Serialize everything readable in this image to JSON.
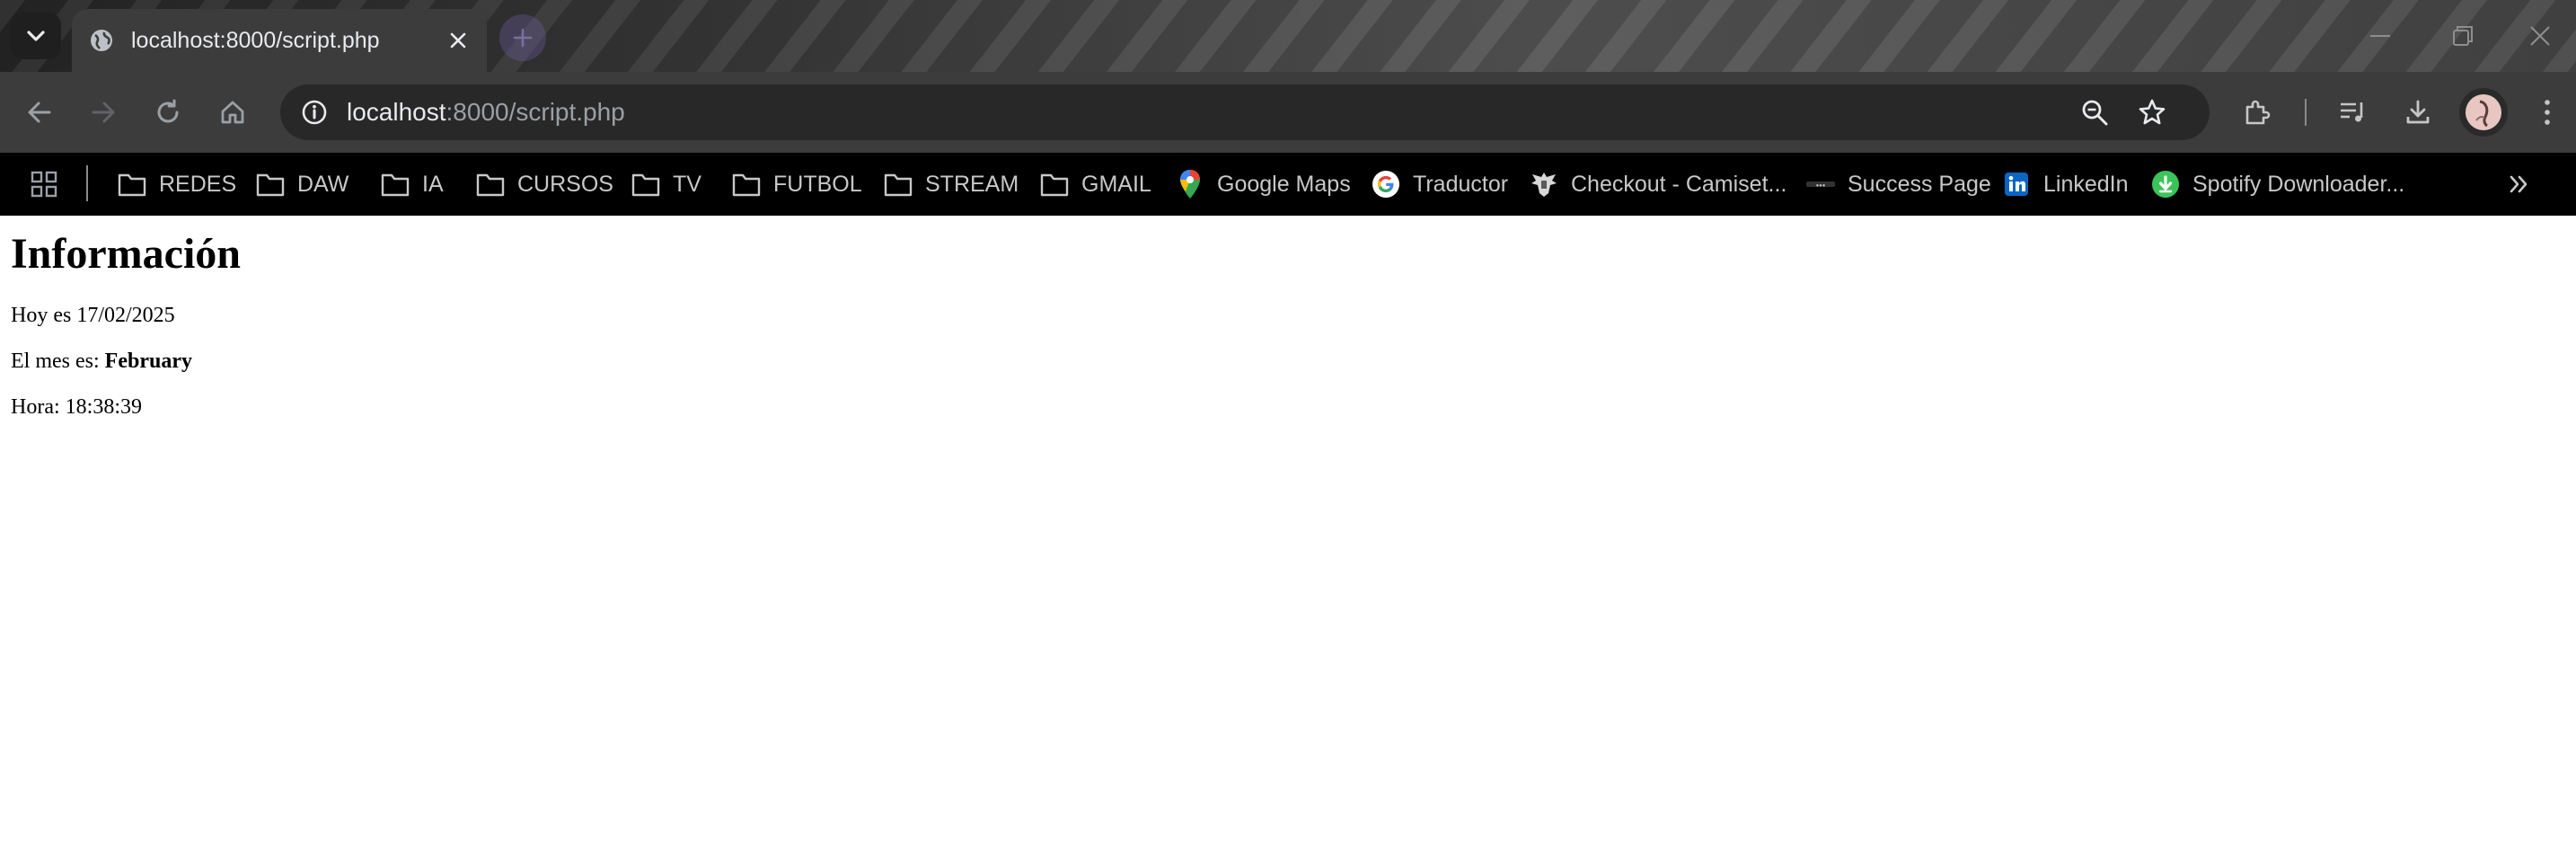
{
  "browser": {
    "tab": {
      "title": "localhost:8000/script.php"
    },
    "address_bar": {
      "host": "localhost",
      "path": ":8000/script.php"
    },
    "bookmarks": [
      {
        "label": "REDES",
        "icon": "folder-icon"
      },
      {
        "label": "DAW",
        "icon": "folder-icon"
      },
      {
        "label": "IA",
        "icon": "folder-icon"
      },
      {
        "label": "CURSOS",
        "icon": "folder-icon"
      },
      {
        "label": "TV",
        "icon": "folder-icon"
      },
      {
        "label": "FUTBOL",
        "icon": "folder-icon"
      },
      {
        "label": "STREAM",
        "icon": "folder-icon"
      },
      {
        "label": "GMAIL",
        "icon": "folder-icon"
      },
      {
        "label": "Google Maps",
        "icon": "google-maps-icon"
      },
      {
        "label": "Traductor",
        "icon": "google-icon"
      },
      {
        "label": "Checkout - Camiset...",
        "icon": "eagle-crest-icon"
      },
      {
        "label": "Success Page",
        "icon": "site-logo-icon"
      },
      {
        "label": "LinkedIn",
        "icon": "linkedin-icon"
      },
      {
        "label": "Spotify Downloader...",
        "icon": "download-circle-icon"
      }
    ]
  },
  "page": {
    "heading": "Información",
    "date_prefix": "Hoy es ",
    "date_value": "17/02/2025",
    "month_prefix": "El mes es: ",
    "month_value": "February",
    "time_prefix": "Hora: ",
    "time_value": "18:38:39"
  },
  "colors": {
    "toolbar": "#3c3c3c",
    "omnibox": "#282828",
    "bookmarks_bar": "#000000",
    "text_light": "#e8eaed"
  }
}
